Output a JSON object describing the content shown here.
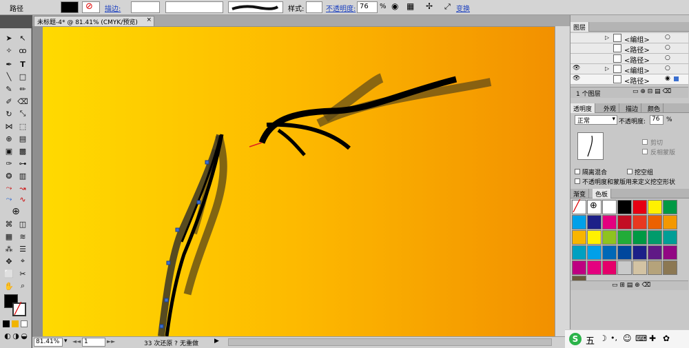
{
  "control": {
    "selection_label": "路径",
    "stroke_label": "描边:",
    "style_label": "样式:",
    "opacity_label": "不透明度:",
    "opacity_value": "76",
    "percent": "%",
    "transform_label": "变换"
  },
  "document": {
    "tab_title": "未标题-4* @ 81.41% (CMYK/预览)",
    "close": "×"
  },
  "status": {
    "zoom": "81.41%",
    "page": "1",
    "undo": "33 次还原 ?",
    "redo": "无重做"
  },
  "layers": {
    "tab": "图层",
    "rows": [
      "<编组>",
      "<路径>",
      "<路径>",
      "<编组>",
      "<路径>"
    ],
    "footer": "1 个图层"
  },
  "transparency": {
    "tabs": [
      "透明度",
      "外观",
      "描边",
      "颜色"
    ],
    "mode": "正常",
    "opacity_label": "不透明度:",
    "opacity_value": "76",
    "clip": "剪切",
    "invert_mask": "反相蒙版",
    "isolate": "隔离混合",
    "knockout": "挖空组",
    "define_knockout": "不透明度和蒙版用来定义挖空形状"
  },
  "swatches": {
    "tabs": [
      "渐变",
      "色板"
    ],
    "colors": [
      "#ffffff",
      "#000000",
      "#e60012",
      "#fff100",
      "#009944",
      "#00a0e9",
      "#1d2088",
      "#e4007f",
      "#c30d23",
      "#e83820",
      "#eb6100",
      "#f39800",
      "#f8b500",
      "#fff100",
      "#8fc31f",
      "#22ac38",
      "#009944",
      "#009b6b",
      "#009e96",
      "#00a0c1",
      "#00a0e9",
      "#0068b7",
      "#00479d",
      "#1d2088",
      "#601986",
      "#920783",
      "#be0081",
      "#e4007f",
      "#e5006a",
      "#c9caca",
      "#d3c3a3",
      "#b5a37b",
      "#8c7853",
      "#6a5a3c"
    ]
  },
  "taskbar": {
    "ime": "五"
  }
}
